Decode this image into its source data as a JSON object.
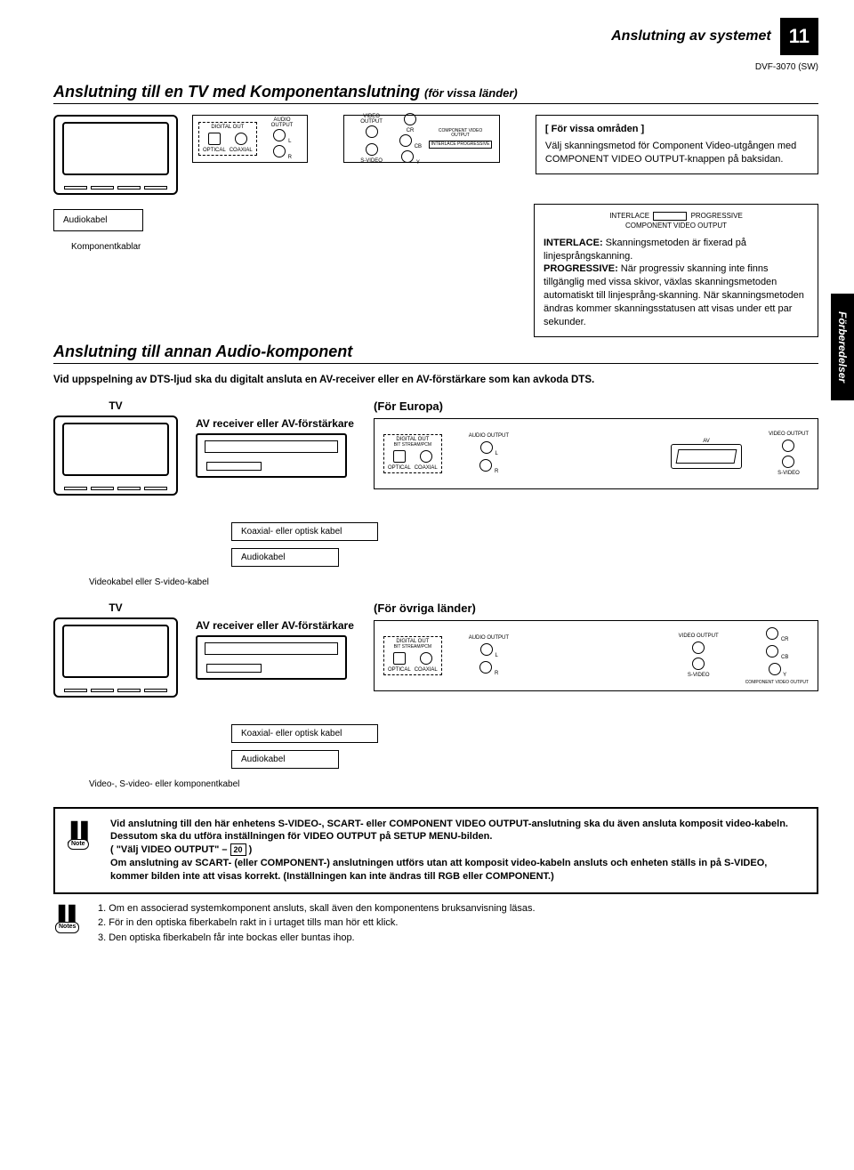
{
  "header": {
    "section_label": "Anslutning av systemet",
    "page_number": "11",
    "model": "DVF-3070 (SW)"
  },
  "section1": {
    "title_main": "Anslutning till en TV med Komponentanslutning",
    "title_sub": "(för vissa länder)",
    "left_panel": {
      "digital_out": "DIGITAL OUT",
      "optical": "OPTICAL",
      "coaxial": "COAXIAL",
      "audio_output": "AUDIO OUTPUT",
      "l": "L",
      "r": "R"
    },
    "right_panel": {
      "video_output": "VIDEO OUTPUT",
      "svideo": "S-VIDEO",
      "cr": "CR",
      "cb": "CB",
      "y": "Y",
      "component_video_output": "COMPONENT VIDEO OUTPUT",
      "interlace": "INTERLACE",
      "progressive": "PROGRESSIVE"
    },
    "info1": {
      "header": "[ För vissa områden ]",
      "body": "Välj skanningsmetod för Component Video-utgången med COMPONENT VIDEO OUTPUT-knappen på baksidan."
    },
    "audiokabel": "Audiokabel",
    "komponentkablar": "Komponentkablar",
    "info2": {
      "switch_left": "INTERLACE",
      "switch_right": "PROGRESSIVE",
      "switch_label": "COMPONENT VIDEO OUTPUT",
      "p1_bold": "INTERLACE:",
      "p1": " Skanningsmetoden är fixerad på linjesprångskanning.",
      "p2_bold": "PROGRESSIVE:",
      "p2": " När progressiv skanning inte finns tillgänglig med vissa skivor, växlas skanningsmetoden automatiskt till linjesprång-skanning. När skanningsmetoden ändras kommer skanningsstatusen att visas under ett par sekunder."
    }
  },
  "side_tab": "Förberedelser",
  "section2": {
    "title": "Anslutning till annan Audio-komponent",
    "intro": "Vid uppspelning av DTS-ljud ska du digitalt ansluta en AV-receiver eller en AV-förstärkare som kan avkoda DTS.",
    "tv": "TV",
    "receiver_label": "AV receiver eller AV-förstärkare",
    "europa": "(För Europa)",
    "panel": {
      "digital_out": "DIGITAL OUT",
      "bitstream": "BIT STREAM/PCM",
      "optical": "OPTICAL",
      "coaxial": "COAXIAL",
      "audio_output": "AUDIO OUTPUT",
      "l": "L",
      "r": "R",
      "av": "AV",
      "video_output": "VIDEO OUTPUT",
      "svideo": "S-VIDEO"
    },
    "koax_optisk": "Koaxial- eller optisk kabel",
    "audiokabel": "Audiokabel",
    "video_svideo": "Videokabel eller S-video-kabel"
  },
  "section3": {
    "tv": "TV",
    "receiver_label": "AV receiver eller AV-förstärkare",
    "ovriga": "(För övriga länder)",
    "panel": {
      "digital_out": "DIGITAL OUT",
      "bitstream": "BIT STREAM/PCM",
      "optical": "OPTICAL",
      "coaxial": "COAXIAL",
      "audio_output": "AUDIO OUTPUT",
      "l": "L",
      "r": "R",
      "video_output": "VIDEO OUTPUT",
      "svideo": "S-VIDEO",
      "cr": "CR",
      "cb": "CB",
      "y": "Y",
      "comp": "COMPONENT VIDEO OUTPUT"
    },
    "koax_optisk": "Koaxial- eller optisk kabel",
    "audiokabel": "Audiokabel",
    "video_svideo_komp": "Video-, S-video- eller komponentkabel"
  },
  "note_block": {
    "label": "Note",
    "text1": "Vid anslutning till den här enhetens S-VIDEO-, SCART- eller COMPONENT VIDEO OUTPUT-anslutning ska du även ansluta komposit video-kabeln. Dessutom ska du utföra inställningen för VIDEO OUTPUT på SETUP MENU-bilden.",
    "ref_prefix": "( \"Välj VIDEO OUTPUT\" – ",
    "page_ref": "20",
    "ref_suffix": " )",
    "text2": "Om anslutning av SCART- (eller COMPONENT-) anslutningen utförs utan att komposit video-kabeln ansluts och enheten ställs in på S-VIDEO, kommer bilden inte att visas korrekt. (Inställningen kan inte ändras till RGB eller COMPONENT.)"
  },
  "notes_list": {
    "label": "Notes",
    "n1": "1. Om en associerad systemkomponent ansluts, skall även den komponentens bruksanvisning läsas.",
    "n2": "2. För in den optiska fiberkabeln rakt in i urtaget tills man hör ett klick.",
    "n3": "3. Den optiska fiberkabeln får inte bockas eller buntas ihop."
  }
}
